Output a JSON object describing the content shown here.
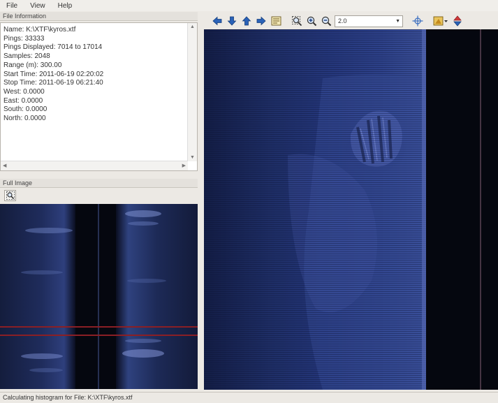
{
  "menu": [
    "File",
    "View",
    "Help"
  ],
  "file_info": {
    "title": "File Information",
    "lines": [
      "Name: K:\\XTF\\kyros.xtf",
      "Pings: 33333",
      "Pings Displayed: 7014 to 17014",
      "Samples: 2048",
      "Range (m): 300.00",
      "Start Time: 2011-06-19 02:20:02",
      "Stop Time: 2011-06-19 06:21:40",
      "West: 0.0000",
      "East: 0.0000",
      "South: 0.0000",
      "North: 0.0000"
    ]
  },
  "full_image": {
    "title": "Full Image",
    "zoom_icon": "magnifier-icon"
  },
  "toolbar": {
    "icons": [
      "arrow-left-icon",
      "arrow-down-icon",
      "arrow-up-icon",
      "arrow-right-icon",
      "measure-icon",
      "zoom-rect-icon",
      "zoom-in-icon",
      "zoom-out-icon"
    ],
    "zoom_value": "2.0",
    "extra_icons": [
      "crosshair-icon",
      "palette-icon",
      "navigate-icon"
    ]
  },
  "status": "Calculating histogram for File: K:\\XTF\\kyros.xtf",
  "colors": {
    "sonar_dark": "#05070f",
    "sonar_blue": "#2c3f82",
    "track_red": "#8a1f25",
    "toolbar_blue": "#2a62b8"
  }
}
